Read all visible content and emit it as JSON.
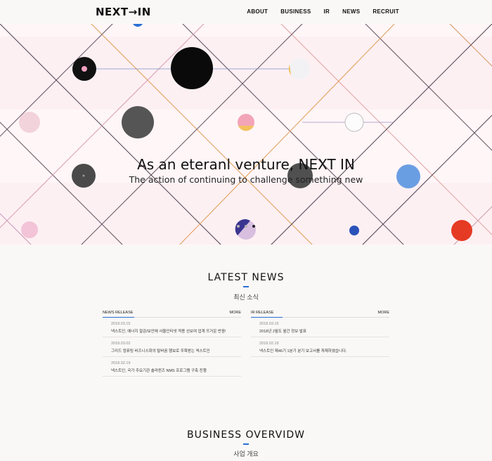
{
  "header": {
    "logo": "NEXT→IN",
    "nav": [
      "ABOUT",
      "BUSINESS",
      "IR",
      "NEWS",
      "RECRUIT"
    ]
  },
  "hero": {
    "title": "As an eteranl venture, NEXT IN",
    "subtitle": "The action of continuing to challenge something new",
    "slides": 3,
    "active_slide": 3
  },
  "latest_news": {
    "title": "LATEST NEWS",
    "subtitle": "최신 소식",
    "news_release": {
      "label": "NEWS RELEASE",
      "more": "MORE",
      "items": [
        {
          "date": "2018.03.15",
          "title": "넥스트인, 에너지 절감/보안에 사물인터넷 적용 선보여 업계 뜨거운 반응!"
        },
        {
          "date": "2018.03.02",
          "title": "그리드 컴퓨팅 비즈니스화의 탈바꿈 행보로 주목받는 넥스트인"
        },
        {
          "date": "2018.02.19",
          "title": "넥스트인, 국가 주요기관 솔라윈즈 NMS 프로그램 구축 진행"
        }
      ]
    },
    "ir_release": {
      "label": "IR RELEASE",
      "more": "MORE",
      "items": [
        {
          "date": "2018.03.15",
          "title": "2018년 2월도 월간 정보 발표"
        },
        {
          "date": "2018.02.18",
          "title": "넥스트인 제46기 1분기 분기 보고서를 게재하였습니다."
        }
      ]
    }
  },
  "business_overview": {
    "title": "BUSINESS OVERVIDW",
    "subtitle": "사업 개요"
  },
  "colors": {
    "accent": "#2a6fd6",
    "hero_bg": "#fdf0f3",
    "page_bg": "#faf8f7"
  }
}
